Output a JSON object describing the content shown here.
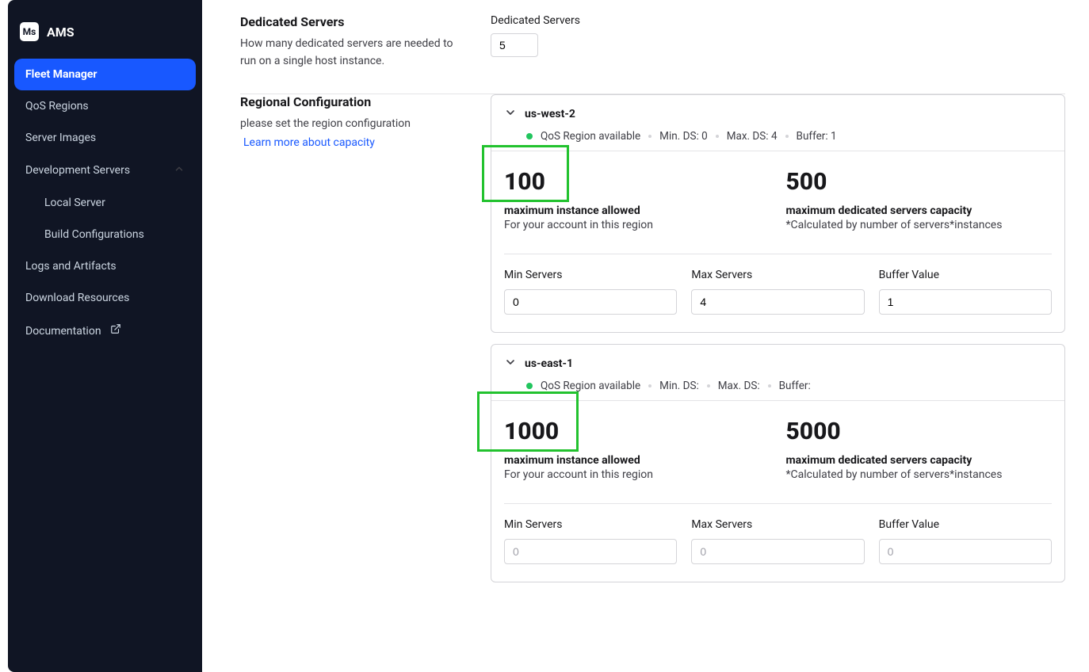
{
  "app": {
    "icon_text": "Ms",
    "title": "AMS"
  },
  "sidebar": {
    "items": [
      {
        "label": "Fleet Manager",
        "active": true
      },
      {
        "label": "QoS Regions"
      },
      {
        "label": "Server Images"
      },
      {
        "label": "Development Servers",
        "expanded": true,
        "children": [
          {
            "label": "Local Server"
          },
          {
            "label": "Build Configurations"
          }
        ]
      },
      {
        "label": "Logs and Artifacts"
      },
      {
        "label": "Download Resources"
      },
      {
        "label": "Documentation",
        "external": true
      }
    ]
  },
  "dedicated_section": {
    "title": "Dedicated Servers",
    "desc": "How many dedicated servers are needed to run on a single host instance.",
    "field_label": "Dedicated Servers",
    "value": "5"
  },
  "region_section": {
    "title": "Regional Configuration",
    "desc": "please set the region configuration",
    "learn_more": "Learn more about capacity",
    "status_label": "QoS Region available",
    "stat_labels": {
      "max_instance_title": "maximum instance allowed",
      "max_instance_sub": "For your account in this region",
      "max_capacity_title": "maximum dedicated servers capacity",
      "max_capacity_sub": "*Calculated by number of servers*instances",
      "min_servers": "Min Servers",
      "max_servers": "Max Servers",
      "buffer_value": "Buffer Value",
      "min_ds_prefix": "Min. DS:",
      "max_ds_prefix": "Max. DS:",
      "buffer_prefix": "Buffer:"
    },
    "regions": [
      {
        "name": "us-west-2",
        "meta": {
          "min_ds": "0",
          "max_ds": "4",
          "buffer": "1"
        },
        "max_instance": "100",
        "max_capacity": "500",
        "inputs": {
          "min": "0",
          "max": "4",
          "buffer": "1",
          "placeholder": ""
        }
      },
      {
        "name": "us-east-1",
        "meta": {
          "min_ds": "",
          "max_ds": "",
          "buffer": ""
        },
        "max_instance": "1000",
        "max_capacity": "5000",
        "inputs": {
          "min": "",
          "max": "",
          "buffer": "",
          "placeholder": "0"
        }
      }
    ]
  }
}
